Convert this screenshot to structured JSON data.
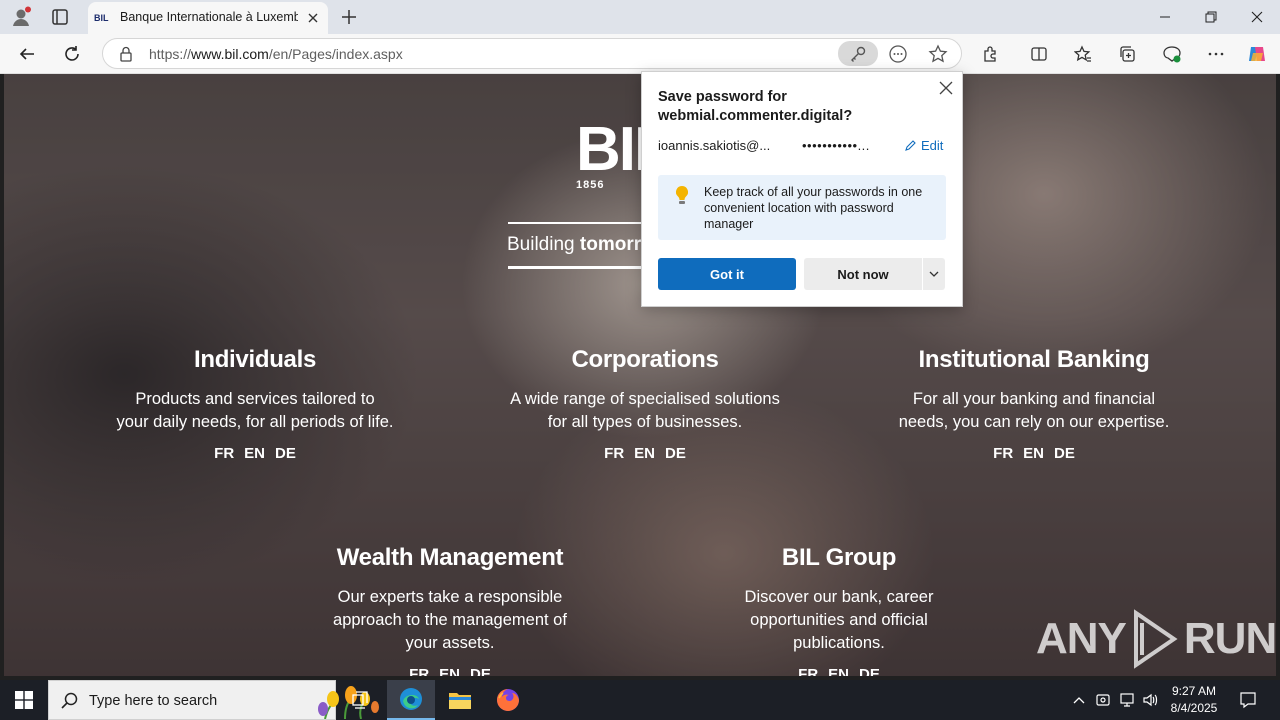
{
  "browser": {
    "tab_title": "Banque Internationale à Luxembourg",
    "tab_favicon": "BIL",
    "url_prefix": "https://",
    "url_domain": "www.bil.com",
    "url_path": "/en/Pages/index.aspx"
  },
  "hero": {
    "logo_text": "BIL",
    "logo_year": "1856",
    "tagline_regular": "Building ",
    "tagline_bold": "tomorr"
  },
  "sections": [
    {
      "title": "Individuals",
      "line1": "Products and services tailored to",
      "line2": "your daily needs, for all periods of life.",
      "langs": [
        "FR",
        "EN",
        "DE"
      ]
    },
    {
      "title": "Corporations",
      "line1": "A wide range of specialised solutions",
      "line2": "for all types of businesses.",
      "langs": [
        "FR",
        "EN",
        "DE"
      ]
    },
    {
      "title": "Institutional Banking",
      "line1": "For all your banking and financial",
      "line2": "needs, you can rely on our expertise.",
      "langs": [
        "FR",
        "EN",
        "DE"
      ]
    },
    {
      "title": "Wealth Management",
      "line1": "Our experts take a responsible",
      "line2": "approach to the management of",
      "line3": "your assets.",
      "langs": [
        "FR",
        "EN",
        "DE"
      ]
    },
    {
      "title": "BIL Group",
      "line1": "Discover our bank, career",
      "line2": "opportunities and official",
      "line3": "publications.",
      "langs": [
        "FR",
        "EN",
        "DE"
      ]
    }
  ],
  "password_popup": {
    "title_line1": "Save password for",
    "title_line2": "webmial.commenter.digital?",
    "username": "ioannis.sakiotis@...",
    "password": "•••••••••••...",
    "edit_label": "Edit",
    "tip": "Keep track of all your passwords in one convenient location with password manager",
    "got_it": "Got it",
    "not_now": "Not now"
  },
  "watermark": {
    "left": "ANY",
    "right": "RUN"
  },
  "taskbar": {
    "search_placeholder": "Type here to search",
    "time": "9:27 AM",
    "date": "8/4/2025"
  },
  "colors": {
    "accent": "#0f6cbd",
    "taskbar": "#1c1f26",
    "tip_bg": "#e9f2fb"
  }
}
